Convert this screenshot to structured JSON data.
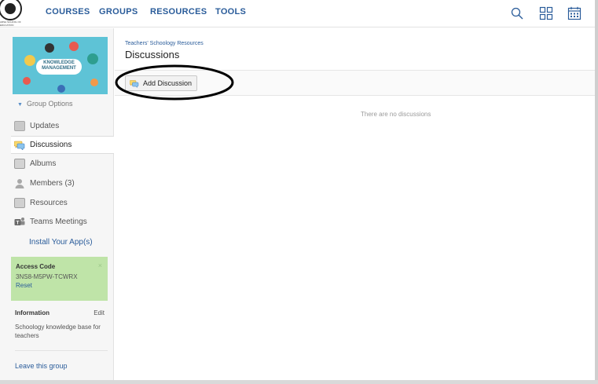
{
  "logo": {
    "caption_line1": "ARSH SCHOOL OF",
    "caption_line2": "EDUCATION"
  },
  "nav": {
    "items": [
      {
        "label": "COURSES"
      },
      {
        "label": "GROUPS"
      },
      {
        "label": "RESOURCES"
      },
      {
        "label": "TOOLS"
      }
    ]
  },
  "topbar_icons": [
    "search-icon",
    "grid-icon",
    "calendar-icon"
  ],
  "group_image": {
    "title_line1": "KNOWLEDGE",
    "title_line2": "MANAGEMENT"
  },
  "sidebar": {
    "group_options": "Group Options",
    "items": [
      {
        "label": "Updates",
        "icon": "updates-icon"
      },
      {
        "label": "Discussions",
        "icon": "discussions-icon",
        "active": true
      },
      {
        "label": "Albums",
        "icon": "albums-icon"
      },
      {
        "label": "Members (3)",
        "icon": "members-icon"
      },
      {
        "label": "Resources",
        "icon": "resources-icon"
      },
      {
        "label": "Teams Meetings",
        "icon": "teams-icon"
      }
    ],
    "install": "Install Your App(s)",
    "access_code": {
      "title": "Access Code",
      "code": "3NS8-M5PW-TCWRX",
      "reset": "Reset",
      "close": "×"
    },
    "information": {
      "title": "Information",
      "edit": "Edit",
      "text": "Schoology knowledge base for teachers"
    },
    "leave": "Leave this group"
  },
  "main": {
    "breadcrumb": "Teachers' Schoology Resources",
    "title": "Discussions",
    "add_button": "Add Discussion",
    "empty": "There are no discussions"
  },
  "colors": {
    "link": "#2a5c9a",
    "access_box": "#bfe4a8",
    "sidebar_bg": "#f6f6f6",
    "group_image_bg": "#5ec3d6"
  }
}
